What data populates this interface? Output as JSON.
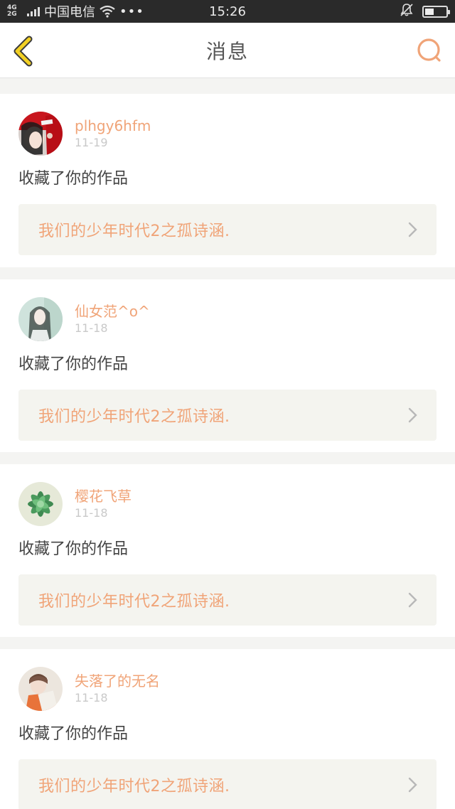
{
  "status_bar": {
    "network": "4G 2G",
    "carrier": "中国电信",
    "more": "•••",
    "time": "15:26"
  },
  "header": {
    "title": "消息",
    "back_icon": "chevron-left-icon",
    "search_icon": "search-icon"
  },
  "colors": {
    "accent": "#f0a478",
    "back_icon": "#f2d024",
    "background": "#f4f4f2",
    "work_bg": "#f4f4ef"
  },
  "messages": [
    {
      "username": "plhgy6hfm",
      "date": "11-19",
      "action": "收藏了你的作品",
      "work_title": "我们的少年时代2之孤诗涵."
    },
    {
      "username": "仙女范^o^",
      "date": "11-18",
      "action": "收藏了你的作品",
      "work_title": "我们的少年时代2之孤诗涵."
    },
    {
      "username": "樱花飞草",
      "date": "11-18",
      "action": "收藏了你的作品",
      "work_title": "我们的少年时代2之孤诗涵."
    },
    {
      "username": "失落了的无名",
      "date": "11-18",
      "action": "收藏了你的作品",
      "work_title": "我们的少年时代2之孤诗涵."
    }
  ]
}
